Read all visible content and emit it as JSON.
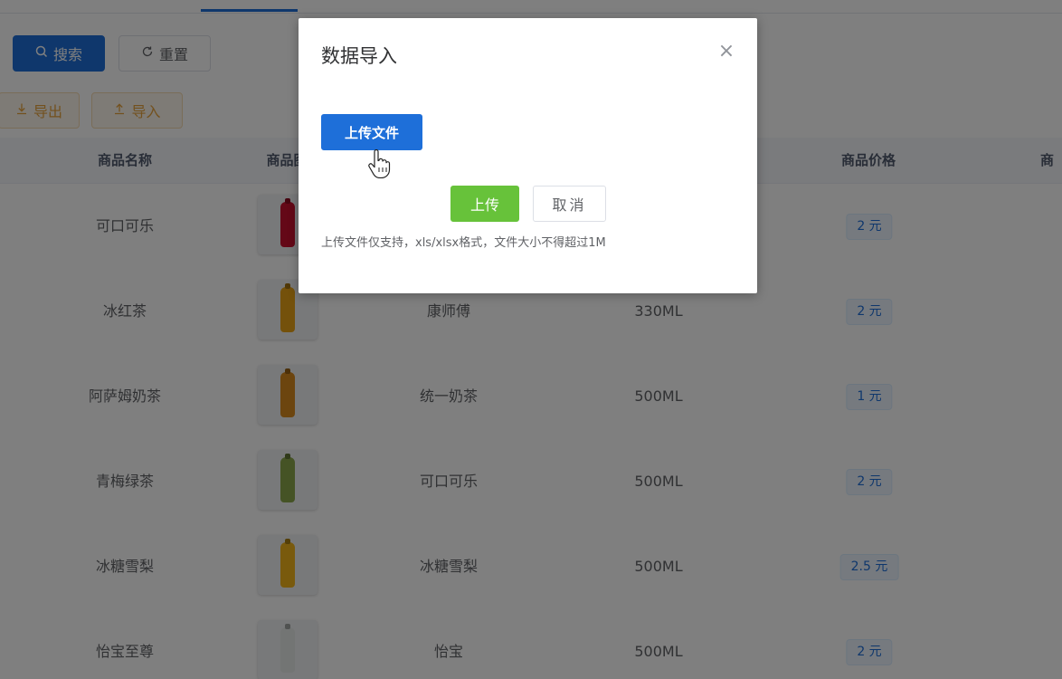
{
  "toolbar": {
    "search_label": "搜索",
    "reset_label": "重置",
    "export_label": "导出",
    "import_label": "导入"
  },
  "icons": {
    "search": "search-icon",
    "reset": "refresh-icon",
    "export": "download-icon",
    "import": "upload-icon",
    "close": "close-icon",
    "cursor": "hand-pointer-icon"
  },
  "table": {
    "headers": [
      "商品名称",
      "商品图",
      "商品价格",
      "商"
    ],
    "rows": [
      {
        "name": "可口可乐",
        "brand": "",
        "spec": "",
        "price": "2 元",
        "bottle_color": "#c8102e"
      },
      {
        "name": "冰红茶",
        "brand": "康师傅",
        "spec": "330ML",
        "price": "2 元",
        "bottle_color": "#e8a317"
      },
      {
        "name": "阿萨姆奶茶",
        "brand": "统一奶茶",
        "spec": "500ML",
        "price": "1 元",
        "bottle_color": "#d98a1e"
      },
      {
        "name": "青梅绿茶",
        "brand": "可口可乐",
        "spec": "500ML",
        "price": "2 元",
        "bottle_color": "#8aa64a"
      },
      {
        "name": "冰糖雪梨",
        "brand": "冰糖雪梨",
        "spec": "500ML",
        "price": "2.5 元",
        "bottle_color": "#f2b51b"
      },
      {
        "name": "怡宝至尊",
        "brand": "怡宝",
        "spec": "500ML",
        "price": "2 元",
        "bottle_color": "#e6ebe8"
      }
    ]
  },
  "dialog": {
    "title": "数据导入",
    "close_symbol": "×",
    "upload_file_label": "上传文件",
    "upload_label": "上传",
    "cancel_label": "取消",
    "tip": "上传文件仅支持，xls/xlsx格式，文件大小不得超过1M"
  },
  "colors": {
    "primary": "#1e6fd9",
    "success": "#67c23a",
    "warning": "#e6a23c",
    "overlay": "rgba(0,0,0,0.5)"
  }
}
